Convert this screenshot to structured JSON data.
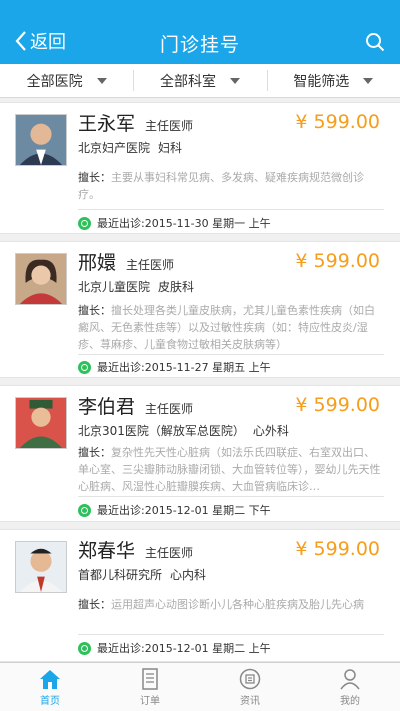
{
  "header": {
    "back_label": "返回",
    "title": "门诊挂号"
  },
  "filters": [
    "全部医院",
    "全部科室",
    "智能筛选"
  ],
  "doctors": [
    {
      "name": "王永军",
      "rank": "主任医师",
      "price": "¥ 599.00",
      "hospital": "北京妇产医院",
      "dept": "妇科",
      "skill_label": "擅长：",
      "skill": "主要从事妇科常见病、多发病、疑难疾病规范微创诊疗。",
      "recent": "最近出诊:2015-11-30 星期一 上午"
    },
    {
      "name": "邢嬛",
      "rank": "主任医师",
      "price": "¥ 599.00",
      "hospital": "北京儿童医院",
      "dept": "皮肤科",
      "skill_label": "擅长：",
      "skill": "擅长处理各类儿童皮肤病，尤其儿童色素性疾病（如白癜风、无色素性痣等）以及过敏性疾病（如：特应性皮炎/湿疹、荨麻疹、儿童食物过敏相关皮肤病等）",
      "recent": "最近出诊:2015-11-27 星期五 上午"
    },
    {
      "name": "李伯君",
      "rank": "主任医师",
      "price": "¥ 599.00",
      "hospital": "北京301医院（解放军总医院）",
      "dept": "心外科",
      "skill_label": "擅长：",
      "skill": "复杂性先天性心脏病（如法乐氏四联症、右室双出口、单心室、三尖瓣肺动脉瓣闭锁、大血管转位等），婴幼儿先天性心脏病、风湿性心脏瓣膜疾病、大血管病临床诊…",
      "recent": "最近出诊:2015-12-01 星期二 下午"
    },
    {
      "name": "郑春华",
      "rank": "主任医师",
      "price": "¥ 599.00",
      "hospital": "首都儿科研究所",
      "dept": "心内科",
      "skill_label": "擅长：",
      "skill": "运用超声心动图诊断小儿各种心脏疾病及胎儿先心病",
      "recent": "最近出诊:2015-12-01 星期二 上午"
    }
  ],
  "tabs": [
    {
      "label": "首页",
      "icon": "home-icon",
      "active": true
    },
    {
      "label": "订单",
      "icon": "order-icon",
      "active": false
    },
    {
      "label": "资讯",
      "icon": "news-icon",
      "active": false
    },
    {
      "label": "我的",
      "icon": "user-icon",
      "active": false
    }
  ],
  "colors": {
    "primary": "#1aa6e8",
    "price": "#f59e1b",
    "status_green": "#2ec05b"
  }
}
